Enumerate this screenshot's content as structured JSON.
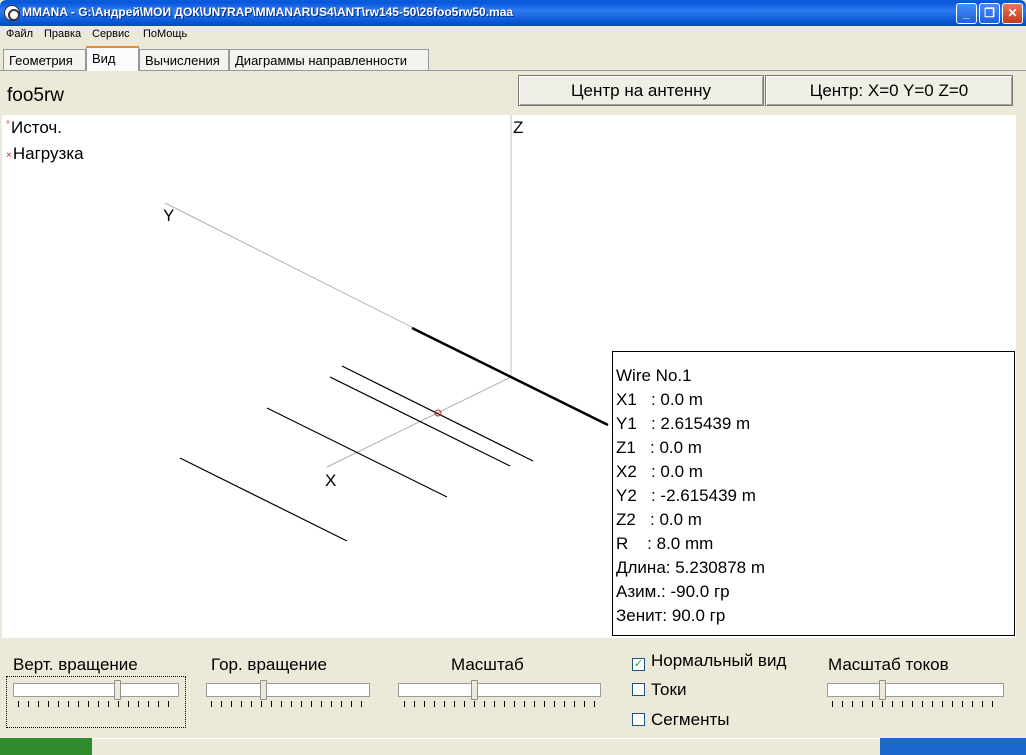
{
  "window": {
    "title": "MMANA - G:\\Андрей\\МОИ ДОК\\UN7RAP\\MMANARUS4\\ANT\\rw145-50\\26foo5rw50.maa",
    "minimize": "_",
    "maximize": "❐",
    "close": "✕"
  },
  "menu": [
    "Файл",
    "Правка",
    "Сервис",
    "ПоМощь"
  ],
  "tabs": [
    "Геометрия",
    "Вид",
    "Вычисления",
    "Диаграммы направленности"
  ],
  "active_tab": "Вид",
  "project_name": "foo5rw",
  "buttons": {
    "center_antenna": "Центр на антенну",
    "center_origin": "Центр: X=0 Y=0 Z=0"
  },
  "view": {
    "legend_source": "Источ.",
    "legend_load": "Нагрузка",
    "axis_z": "Z",
    "axis_y": "Y",
    "axis_x": "X",
    "marker_source": "°",
    "marker_load": "×"
  },
  "wire_info": [
    "Wire No.1",
    "X1   : 0.0 m",
    "Y1   : 2.615439 m",
    "Z1   : 0.0 m",
    "X2   : 0.0 m",
    "Y2   : -2.615439 m",
    "Z2   : 0.0 m",
    "R    : 8.0 mm",
    "Длина: 5.230878 m",
    "Азим.: -90.0 гр",
    "Зенит: 90.0 гр"
  ],
  "controls": {
    "vert_rotation": "Верт. вращение",
    "hor_rotation": "Гор. вращение",
    "scale": "Масштаб",
    "current_scale": "Масштаб токов",
    "normal_view": "Нормальный вид",
    "currents": "Токи",
    "segments": "Сегменты",
    "normal_view_checked": true,
    "currents_checked": false,
    "segments_checked": false,
    "checkmark": "✓"
  }
}
